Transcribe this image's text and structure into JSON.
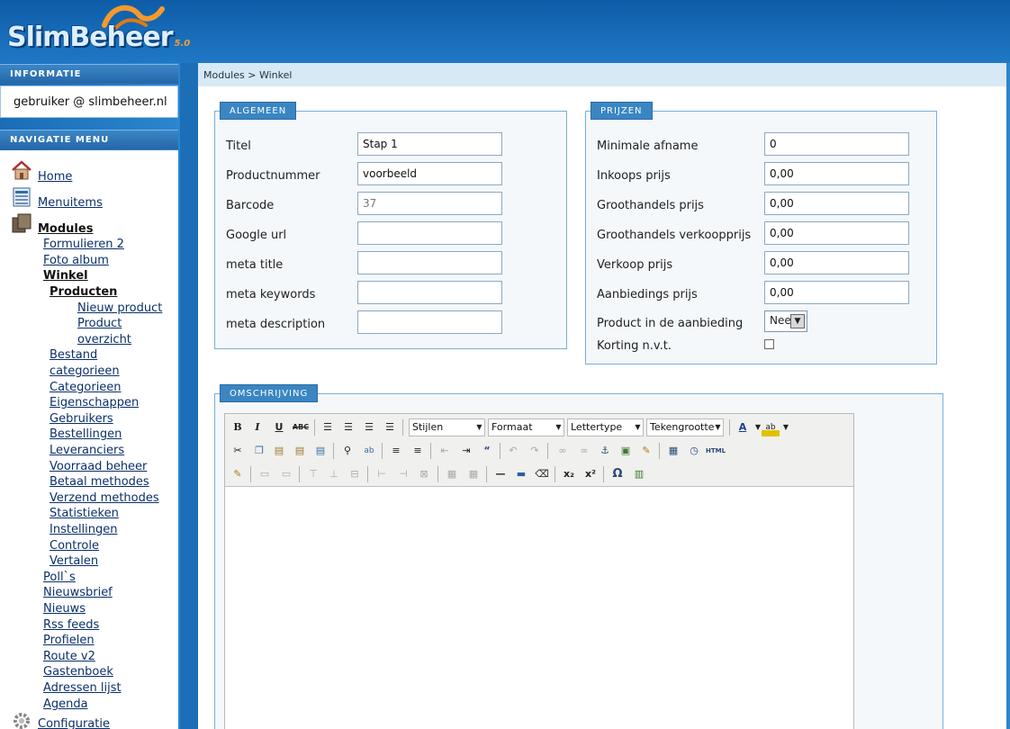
{
  "app": {
    "logo_text": "SlimBeheer",
    "logo_version": "5.0"
  },
  "sidebar": {
    "info_title": "INFORMATIE",
    "user": "gebruiker @ slimbeheer.nl",
    "nav_title": "NAVIGATIE MENU",
    "home": "Home",
    "menuitems": "Menuitems",
    "modules": "Modules",
    "modules_items": [
      "Formulieren 2",
      "Foto album"
    ],
    "winkel": "Winkel",
    "producten": "Producten",
    "producten_items": [
      "Nieuw product",
      "Product",
      "overzicht"
    ],
    "winkel_items": [
      "Bestand",
      "categorieen",
      "Categorieen",
      "Eigenschappen",
      "Gebruikers",
      "Bestellingen",
      "Leveranciers",
      "Voorraad beheer",
      "Betaal methodes",
      "Verzend methodes",
      "Statistieken",
      "Instellingen",
      "Controle",
      "Vertalen"
    ],
    "more_modules": [
      "Poll`s",
      "Nieuwsbrief",
      "Nieuws",
      "Rss feeds",
      "Profielen",
      "Route v2",
      "Gastenboek",
      "Adressen lijst",
      "Agenda"
    ],
    "configuratie": "Configuratie"
  },
  "breadcrumb": "Modules > Winkel",
  "algemeen": {
    "legend": "ALGEMEEN",
    "fields": [
      {
        "label": "Titel",
        "value": "Stap 1"
      },
      {
        "label": "Productnummer",
        "value": "voorbeeld"
      },
      {
        "label": "Barcode",
        "value": "37"
      },
      {
        "label": "Google url",
        "value": ""
      },
      {
        "label": "meta title",
        "value": ""
      },
      {
        "label": "meta keywords",
        "value": ""
      },
      {
        "label": "meta description",
        "value": ""
      }
    ]
  },
  "prijzen": {
    "legend": "PRIJZEN",
    "fields": [
      {
        "label": "Minimale afname",
        "value": "0"
      },
      {
        "label": "Inkoops prijs",
        "value": "0,00"
      },
      {
        "label": "Groothandels prijs",
        "value": "0,00"
      },
      {
        "label": "Groothandels verkoopprijs",
        "value": "0,00"
      },
      {
        "label": "Verkoop prijs",
        "value": "0,00"
      },
      {
        "label": "Aanbiedings prijs",
        "value": "0,00"
      }
    ],
    "aanbieding_label": "Product in de aanbieding",
    "aanbieding_value": "Nee",
    "korting_label": "Korting n.v.t.",
    "korting_checked": false
  },
  "omschrijving": {
    "legend": "OMSCHRIJVING",
    "toolbar": {
      "bold": "B",
      "italic": "I",
      "underline": "U",
      "strike": "ABC",
      "styles": "Stijlen",
      "format": "Formaat",
      "fontface": "Lettertype",
      "fontsize": "Tekengrootte",
      "html": "HTML",
      "omega": "Ω"
    }
  }
}
